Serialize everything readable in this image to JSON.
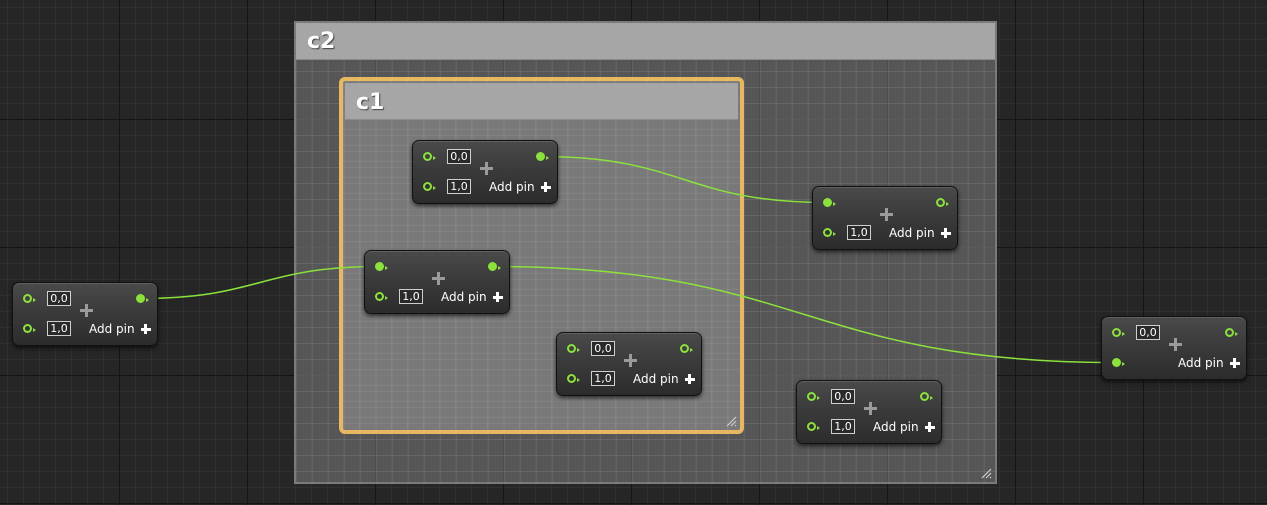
{
  "colors": {
    "canvas_background": "#262626",
    "pin_and_wire": "#8ce23c",
    "inner_comment_border": "#e8b860",
    "comment_header": "#a6a6a6"
  },
  "comments": {
    "outer": {
      "title": "c2"
    },
    "inner": {
      "title": "c1"
    }
  },
  "node_common": {
    "add_pin_label": "Add pin",
    "operator_icon": "plus-icon",
    "add_pin_icon": "plus-icon",
    "pin_icon": "exec-pin-icon"
  },
  "nodes": [
    {
      "id": "node-left",
      "input0": "0,0",
      "input1": "1,0",
      "connections": {
        "in0": false,
        "in1": false,
        "out": true
      }
    },
    {
      "id": "node-c1-top",
      "input0": "0,0",
      "input1": "1,0",
      "connections": {
        "in0": false,
        "in1": false,
        "out": true
      }
    },
    {
      "id": "node-c1-middle",
      "input0": "",
      "input1": "1,0",
      "connections": {
        "in0": true,
        "in1": false,
        "out": true
      }
    },
    {
      "id": "node-c1-bottom",
      "input0": "0,0",
      "input1": "1,0",
      "connections": {
        "in0": false,
        "in1": false,
        "out": false
      }
    },
    {
      "id": "node-c2-right-top",
      "input0": "",
      "input1": "1,0",
      "connections": {
        "in0": true,
        "in1": false,
        "out": false
      }
    },
    {
      "id": "node-c2-right-bottom",
      "input0": "0,0",
      "input1": "1,0",
      "connections": {
        "in0": false,
        "in1": false,
        "out": false
      }
    },
    {
      "id": "node-far-right",
      "input0": "0,0",
      "input1": "",
      "connections": {
        "in0": false,
        "in1": true,
        "out": false
      }
    }
  ],
  "wires": [
    {
      "from": "node-left.out",
      "to": "node-c1-middle.in0"
    },
    {
      "from": "node-c1-top.out",
      "to": "node-c2-right-top.in0"
    },
    {
      "from": "node-c1-middle.out",
      "to": "node-far-right.in1"
    }
  ]
}
